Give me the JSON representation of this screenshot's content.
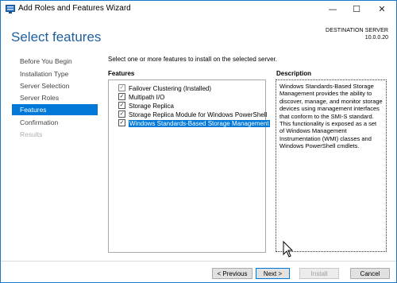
{
  "window": {
    "title": "Add Roles and Features Wizard",
    "minimize": "—",
    "maximize": "☐",
    "close": "✕"
  },
  "header": {
    "page_title": "Select features",
    "destination_label": "DESTINATION SERVER",
    "destination_value": "10.0.0.20"
  },
  "nav": {
    "items": [
      {
        "label": "Before You Begin"
      },
      {
        "label": "Installation Type"
      },
      {
        "label": "Server Selection"
      },
      {
        "label": "Server Roles"
      },
      {
        "label": "Features"
      },
      {
        "label": "Confirmation"
      },
      {
        "label": "Results"
      }
    ],
    "active": "Features",
    "disabled": [
      "Results"
    ]
  },
  "content": {
    "instruction": "Select one or more features to install on the selected server.",
    "features_header": "Features",
    "description_header": "Description",
    "features": [
      {
        "label": "Failover Clustering (Installed)",
        "checked": true,
        "installed": true
      },
      {
        "label": "Multipath I/O",
        "checked": true
      },
      {
        "label": "Storage Replica",
        "checked": true
      },
      {
        "label": "Storage Replica Module for Windows PowerShell",
        "checked": true
      },
      {
        "label": "Windows Standards-Based Storage Management",
        "checked": true,
        "selected": true
      }
    ],
    "description": "Windows Standards-Based Storage Management provides the ability to discover, manage, and monitor storage devices using management interfaces that conform to the SMI-S standard. This functionality is exposed as a set of Windows Management Instrumentation (WMI) classes and Windows PowerShell cmdlets."
  },
  "buttons": {
    "previous": "< Previous",
    "next": "Next >",
    "install": "Install",
    "cancel": "Cancel"
  },
  "colors": {
    "accent": "#0078d7",
    "title": "#1e5f9e"
  }
}
